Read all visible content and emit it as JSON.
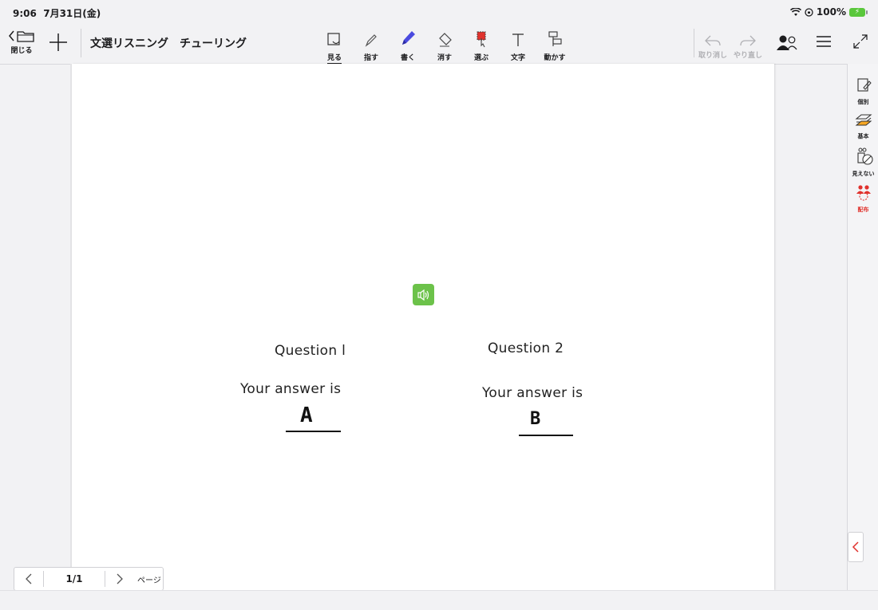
{
  "status": {
    "time": "9:06",
    "date": "7月31日(金)",
    "battery": "100%",
    "icons": [
      "wifi-icon",
      "orientation-lock-icon",
      "battery-charging-icon"
    ]
  },
  "toolbar": {
    "close_label": "閉じる",
    "title": "文選リスニング　チューリング",
    "tools": [
      {
        "label": "見る",
        "icon": "view-icon",
        "active": true
      },
      {
        "label": "指す",
        "icon": "pointer-pen-icon"
      },
      {
        "label": "書く",
        "icon": "write-pen-icon"
      },
      {
        "label": "消す",
        "icon": "eraser-icon"
      },
      {
        "label": "選ぶ",
        "icon": "select-icon"
      },
      {
        "label": "文字",
        "icon": "text-icon"
      },
      {
        "label": "動かす",
        "icon": "move-icon"
      }
    ],
    "undo_label": "取り消し",
    "redo_label": "やり直し",
    "accent_color": "#4a4adf"
  },
  "content": {
    "q1_title": "Question l",
    "q1_prompt": "Your answer is",
    "q1_answer": "A",
    "q2_title": "Question 2",
    "q2_prompt": "Your answer is",
    "q2_answer": "B",
    "speaker_color": "#6cc24a"
  },
  "right_panel": {
    "items": [
      {
        "label": "個別",
        "icon": "individual-icon"
      },
      {
        "label": "基本",
        "icon": "layers-icon"
      },
      {
        "label": "見えない",
        "icon": "hidden-icon"
      },
      {
        "label": "配布",
        "icon": "distribute-icon",
        "color": "#e0322d"
      }
    ]
  },
  "pager": {
    "page": "1/1",
    "label": "ページ"
  }
}
